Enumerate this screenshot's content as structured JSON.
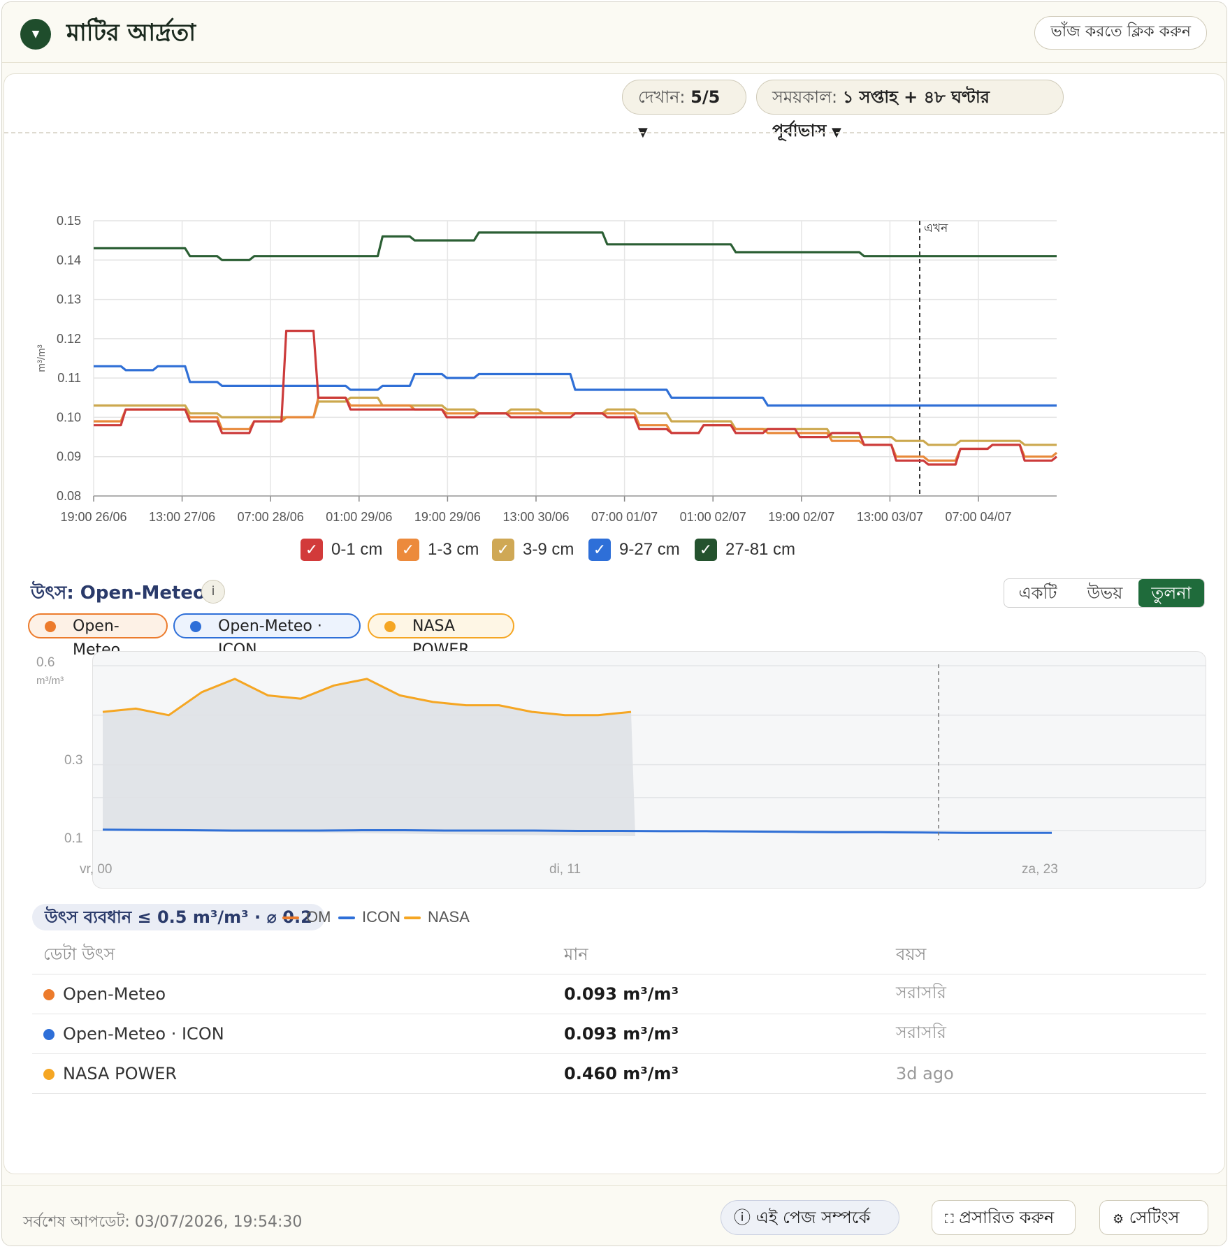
{
  "header": {
    "toggle_glyph": "▼",
    "title": "মাটির আর্দ্রতা",
    "collapse_label": "ভাঁজ করতে ক্লিক করুন"
  },
  "controls": {
    "show_label": "দেখান:",
    "show_value": "5/5",
    "period_label": "সময়কাল:",
    "period_value": "১ সপ্তাহ + ৪৮ ঘণ্টার পূর্বাভাস",
    "caret": "▼"
  },
  "chart_data": [
    {
      "type": "line",
      "ylabel": "m³/m³",
      "ylim": [
        0.08,
        0.15
      ],
      "yticks": [
        "0.15",
        "0.14",
        "0.13",
        "0.12",
        "0.11",
        "0.10",
        "0.09",
        "0.08"
      ],
      "xticks": [
        "19:00 26/06",
        "13:00 27/06",
        "07:00 28/06",
        "01:00 29/06",
        "19:00 29/06",
        "13:00 30/06",
        "07:00 01/07",
        "01:00 02/07",
        "19:00 02/07",
        "13:00 03/07",
        "07:00 04/07"
      ],
      "now_label": "এখন",
      "grid": true,
      "colors": [
        "#cc3b3b",
        "#e8893a",
        "#cca84e",
        "#2f6fd6",
        "#24522e"
      ],
      "series": [
        {
          "name": "27-81 cm",
          "color": "#2b5f34",
          "values": [
            0.143,
            0.143,
            0.143,
            0.141,
            0.14,
            0.141,
            0.141,
            0.141,
            0.141,
            0.146,
            0.145,
            0.145,
            0.147,
            0.147,
            0.147,
            0.147,
            0.144,
            0.144,
            0.144,
            0.144,
            0.142,
            0.142,
            0.142,
            0.142,
            0.141,
            0.141,
            0.141,
            0.141,
            0.141,
            0.141,
            0.141
          ]
        },
        {
          "name": "9-27 cm",
          "color": "#2f6fd6",
          "values": [
            0.113,
            0.112,
            0.113,
            0.109,
            0.108,
            0.108,
            0.108,
            0.108,
            0.107,
            0.108,
            0.111,
            0.11,
            0.111,
            0.111,
            0.111,
            0.107,
            0.107,
            0.107,
            0.105,
            0.105,
            0.105,
            0.103,
            0.103,
            0.103,
            0.103,
            0.103,
            0.103,
            0.103,
            0.103,
            0.103,
            0.103
          ]
        },
        {
          "name": "3-9 cm",
          "color": "#cca84e",
          "values": [
            0.103,
            0.103,
            0.103,
            0.101,
            0.1,
            0.1,
            0.1,
            0.104,
            0.105,
            0.103,
            0.103,
            0.102,
            0.101,
            0.102,
            0.101,
            0.101,
            0.102,
            0.101,
            0.099,
            0.099,
            0.097,
            0.097,
            0.097,
            0.095,
            0.095,
            0.094,
            0.093,
            0.094,
            0.094,
            0.093,
            0.093
          ]
        },
        {
          "name": "1-3 cm",
          "color": "#e8893a",
          "values": [
            0.099,
            0.102,
            0.102,
            0.1,
            0.097,
            0.099,
            0.1,
            0.105,
            0.103,
            0.103,
            0.102,
            0.101,
            0.101,
            0.101,
            0.101,
            0.101,
            0.101,
            0.098,
            0.096,
            0.098,
            0.097,
            0.096,
            0.096,
            0.094,
            0.093,
            0.09,
            0.089,
            0.092,
            0.093,
            0.09,
            0.091
          ]
        },
        {
          "name": "0-1 cm",
          "color": "#cc3b3b",
          "values": [
            0.098,
            0.102,
            0.102,
            0.099,
            0.096,
            0.099,
            0.122,
            0.105,
            0.102,
            0.102,
            0.102,
            0.1,
            0.101,
            0.1,
            0.1,
            0.101,
            0.1,
            0.097,
            0.096,
            0.098,
            0.096,
            0.097,
            0.095,
            0.096,
            0.093,
            0.089,
            0.088,
            0.092,
            0.093,
            0.089,
            0.09
          ]
        }
      ]
    },
    {
      "type": "area",
      "ylabel": "m³/m³",
      "ylim": [
        0.1,
        0.6
      ],
      "yticks": [
        "0.6",
        "0.3",
        "0.1"
      ],
      "xticks": [
        "vr, 00",
        "di, 11",
        "za, 23"
      ],
      "series": [
        {
          "name": "NASA",
          "color": "#f5a623",
          "values": [
            0.46,
            0.47,
            0.45,
            0.52,
            0.56,
            0.51,
            0.5,
            0.54,
            0.56,
            0.51,
            0.49,
            0.48,
            0.48,
            0.46,
            0.45,
            0.45,
            0.46
          ]
        },
        {
          "name": "ICON",
          "color": "#2f6fd6",
          "values": [
            0.103,
            0.102,
            0.101,
            0.1,
            0.1,
            0.1,
            0.101,
            0.101,
            0.1,
            0.1,
            0.1,
            0.099,
            0.099,
            0.098,
            0.098,
            0.097,
            0.096,
            0.095,
            0.095,
            0.094,
            0.093,
            0.093,
            0.093
          ]
        }
      ]
    }
  ],
  "legend": [
    {
      "label": "0-1 cm",
      "color": "#d23a3a"
    },
    {
      "label": "1-3 cm",
      "color": "#ec8a3c"
    },
    {
      "label": "3-9 cm",
      "color": "#cfa855"
    },
    {
      "label": "9-27 cm",
      "color": "#2e6fd8"
    },
    {
      "label": "27-81 cm",
      "color": "#24522e"
    }
  ],
  "check_glyph": "✓",
  "source": {
    "prefix": "উৎস:",
    "name": "Open-Meteo",
    "info_glyph": "i",
    "modes": [
      "একটি",
      "উভয়",
      "তুলনা"
    ],
    "active_mode": "তুলনা",
    "chips": [
      {
        "label": "Open-Meteo",
        "color": "#ec7b2c"
      },
      {
        "label": "Open-Meteo · ICON",
        "color": "#2e6fd8"
      },
      {
        "label": "NASA POWER",
        "color": "#f5a623"
      }
    ]
  },
  "divergence": {
    "badge": "উৎস ব্যবধান ≤ 0.5 m³/m³ · ⌀ 0.2",
    "mini_legend": [
      {
        "label": "OM",
        "color": "#ec7b2c"
      },
      {
        "label": "ICON",
        "color": "#2e6fd8"
      },
      {
        "label": "NASA",
        "color": "#f5a623"
      }
    ]
  },
  "table": {
    "headers": [
      "ডেটা উৎস",
      "মান",
      "বয়স"
    ],
    "rows": [
      {
        "source": "Open-Meteo",
        "color": "#ec7b2c",
        "value": "0.093 m³/m³",
        "age": "সরাসরি"
      },
      {
        "source": "Open-Meteo · ICON",
        "color": "#2e6fd8",
        "value": "0.093 m³/m³",
        "age": "সরাসরি"
      },
      {
        "source": "NASA POWER",
        "color": "#f5a623",
        "value": "0.460 m³/m³",
        "age": "3d ago"
      }
    ]
  },
  "footer": {
    "last_update": "সর্বশেষ আপডেট: 03/07/2026, 19:54:30",
    "about_label": "এই পেজ সম্পর্কে",
    "expand_label": "প্রসারিত করুন",
    "settings_label": "সেটিংস",
    "about_icon": "ⓘ",
    "expand_icon": "⛶",
    "settings_icon": "⚙"
  }
}
